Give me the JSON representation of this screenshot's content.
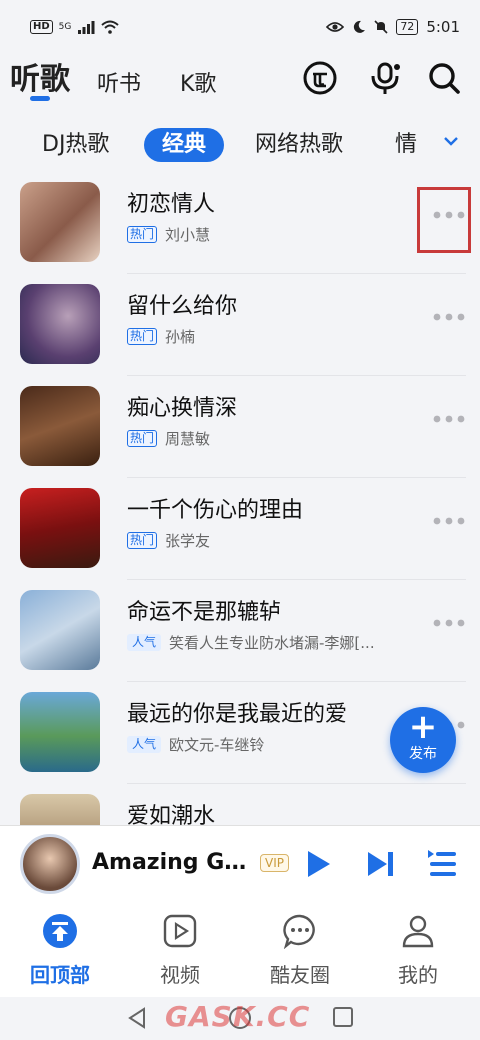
{
  "status_bar": {
    "network": "HD",
    "signal_type": "5G",
    "battery": "72",
    "time": "5:01"
  },
  "top_nav": {
    "tabs": [
      "听歌",
      "听书",
      "K歌"
    ],
    "active": "听歌",
    "icons": [
      "free-icon",
      "voice-search-icon",
      "search-icon"
    ]
  },
  "categories": {
    "items": [
      "DJ热歌",
      "经典",
      "网络热歌",
      "情"
    ],
    "active": "经典"
  },
  "songs": [
    {
      "title": "初恋情人",
      "tag": "热门",
      "artist": "刘小慧"
    },
    {
      "title": "留什么给你",
      "tag": "热门",
      "artist": "孙楠"
    },
    {
      "title": "痴心换情深",
      "tag": "热门",
      "artist": "周慧敏"
    },
    {
      "title": "一千个伤心的理由",
      "tag": "热门",
      "artist": "张学友"
    },
    {
      "title": "命运不是那辘轳",
      "tag": "人气",
      "artist": "笑看人生专业防水堵漏-李娜[..."
    },
    {
      "title": "最远的你是我最近的爱",
      "tag": "人气",
      "artist": "欧文元-车继铃"
    },
    {
      "title": "爱如潮水",
      "tag": "",
      "artist": ""
    }
  ],
  "fab": {
    "label": "发布"
  },
  "player": {
    "title": "Amazing Gra...",
    "badge": "VIP"
  },
  "bottom_tabs": [
    {
      "label": "回顶部",
      "icon": "back-to-top-icon"
    },
    {
      "label": "视频",
      "icon": "video-icon"
    },
    {
      "label": "酷友圈",
      "icon": "chat-bubble-icon"
    },
    {
      "label": "我的",
      "icon": "profile-icon"
    }
  ],
  "watermark": "GASK.CC",
  "colors": {
    "accent": "#1f6fe5",
    "highlight_box": "#c83a3a"
  }
}
